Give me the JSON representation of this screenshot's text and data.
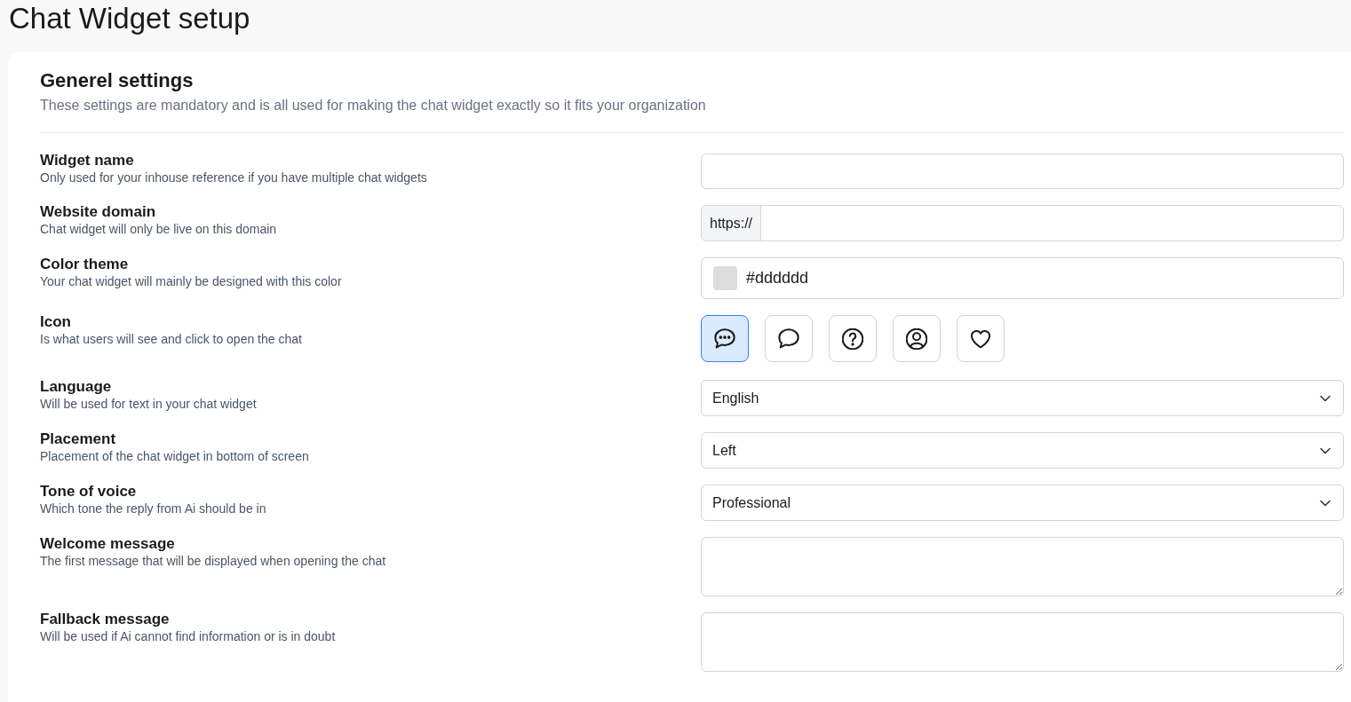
{
  "page_title": "Chat Widget setup",
  "section": {
    "title": "Generel settings",
    "description": "These settings are mandatory and is all used for making the chat widget exactly so it fits your organization"
  },
  "settings": [
    {
      "kind": "text",
      "label": "Widget name",
      "description": "Only used for your inhouse reference if you have multiple chat widgets"
    },
    {
      "kind": "prefixed",
      "label": "Website domain",
      "description": "Chat widget will only be live on this domain",
      "prefix": "https://"
    },
    {
      "kind": "color",
      "label": "Color theme",
      "description": "Your chat widget will mainly be designed with this color",
      "value": "#dddddd"
    },
    {
      "kind": "icons",
      "label": "Icon",
      "description": "Is what users will see and click to open the chat",
      "options": [
        {
          "kind": "chat-dots",
          "selected": true
        },
        {
          "kind": "chat",
          "selected": false
        },
        {
          "kind": "question",
          "selected": false
        },
        {
          "kind": "user",
          "selected": false
        },
        {
          "kind": "heart",
          "selected": false
        }
      ]
    },
    {
      "kind": "select",
      "label": "Language",
      "description": "Will be used for text in your chat widget",
      "value": "English"
    },
    {
      "kind": "select",
      "label": "Placement",
      "description": "Placement of the chat widget in bottom of screen",
      "value": "Left"
    },
    {
      "kind": "select",
      "label": "Tone of voice",
      "description": "Which tone the reply from Ai should be in",
      "value": "Professional"
    },
    {
      "kind": "textarea",
      "label": "Welcome message",
      "description": "The first message that will be displayed when opening the chat"
    },
    {
      "kind": "textarea",
      "label": "Fallback message",
      "description": "Will be used if Ai cannot find information or is in doubt"
    }
  ]
}
